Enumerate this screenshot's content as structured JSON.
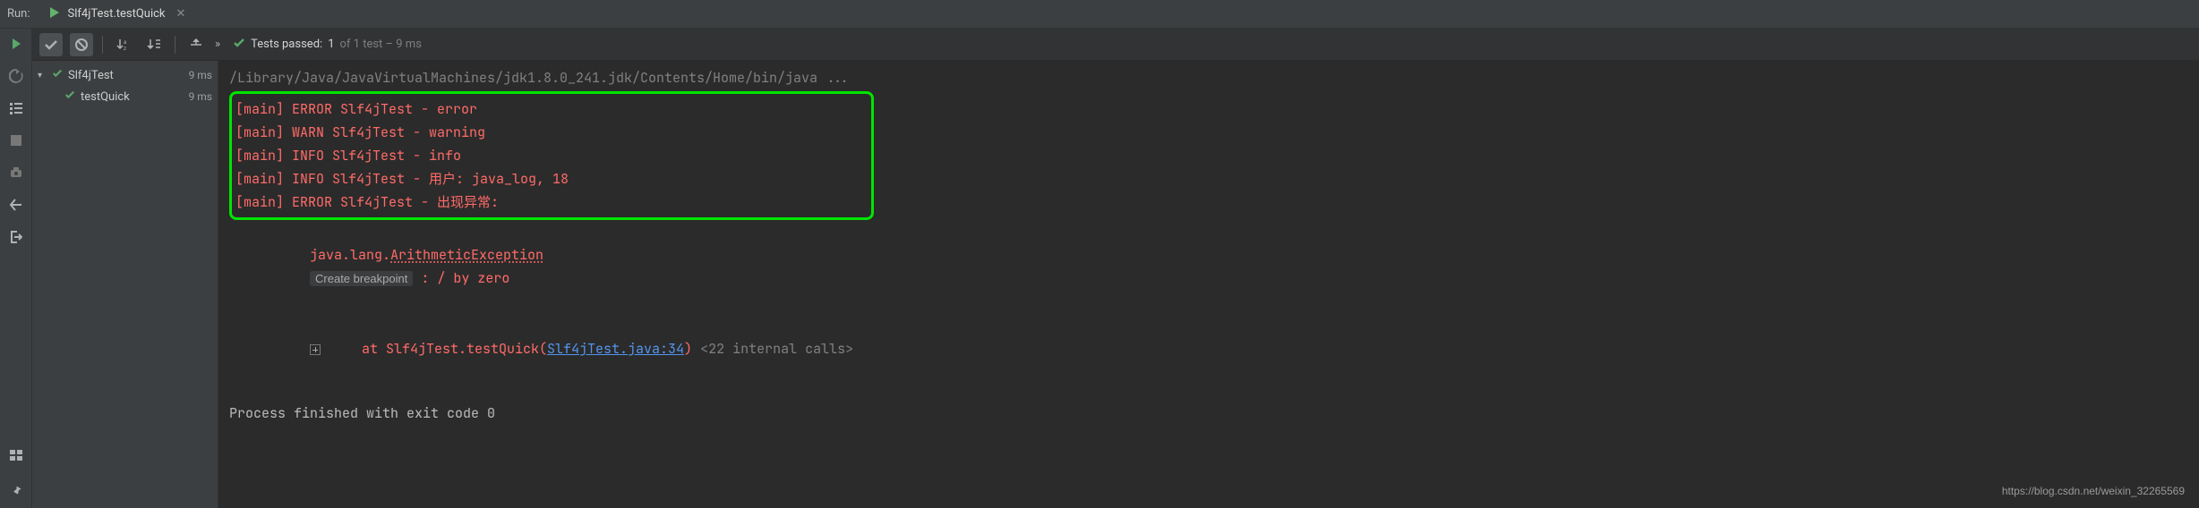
{
  "header": {
    "run_label": "Run:",
    "tab_label": "Slf4jTest.testQuick"
  },
  "toolbar": {
    "status_prefix": "Tests passed:",
    "status_count": "1",
    "status_suffix": "of 1 test – 9 ms"
  },
  "tree": {
    "root": {
      "name": "Slf4jTest",
      "time": "9 ms"
    },
    "child": {
      "name": "testQuick",
      "time": "9 ms"
    }
  },
  "console": {
    "cmd": "/Library/Java/JavaVirtualMachines/jdk1.8.0_241.jdk/Contents/Home/bin/java ...",
    "logs": [
      "[main] ERROR Slf4jTest - error",
      "[main] WARN Slf4jTest - warning",
      "[main] INFO Slf4jTest - info",
      "[main] INFO Slf4jTest - 用户: java_log, 18",
      "[main] ERROR Slf4jTest - 出现异常:"
    ],
    "exception_prefix": "java.lang.",
    "exception_class": "ArithmeticException",
    "create_bp": "Create breakpoint",
    "exception_msg": " : / by zero",
    "stack_at": "    at Slf4jTest.testQuick(",
    "stack_link": "Slf4jTest.java:34",
    "stack_close": ")",
    "internal_calls": " <22 internal calls>",
    "exit": "Process finished with exit code 0"
  },
  "watermark": "https://blog.csdn.net/weixin_32265569"
}
